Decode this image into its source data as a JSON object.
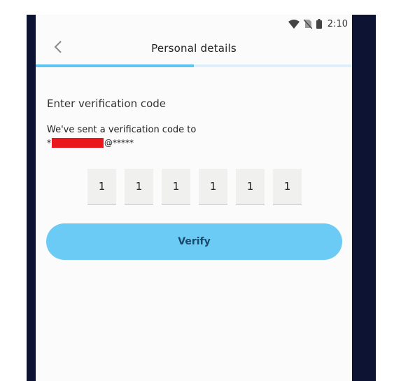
{
  "status_bar": {
    "time": "2:10",
    "icons": [
      "wifi-icon",
      "no-sim-icon",
      "battery-icon"
    ]
  },
  "header": {
    "title": "Personal details",
    "back_icon": "chevron-left-icon"
  },
  "progress": {
    "fraction": 0.5,
    "color": "#5ec4f2"
  },
  "content": {
    "heading": "Enter verification code",
    "sent_text": "We've sent a verification code to",
    "email_prefix": "*",
    "email_suffix": "@*****"
  },
  "code_digits": [
    "1",
    "1",
    "1",
    "1",
    "1",
    "1"
  ],
  "verify_button": {
    "label": "Verify",
    "color": "#6ccbf4"
  }
}
